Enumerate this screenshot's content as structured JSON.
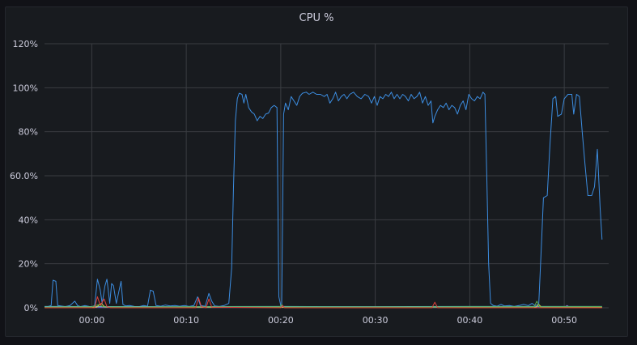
{
  "panel": {
    "title": "CPU %"
  },
  "chart_data": {
    "type": "line",
    "title": "CPU %",
    "ylim": [
      0,
      120
    ],
    "y_ticks": [
      "0%",
      "20%",
      "40%",
      "60.0%",
      "80%",
      "100%",
      "120%"
    ],
    "y_tick_values": [
      0,
      20,
      40,
      60,
      80,
      100,
      120
    ],
    "x_domain_minutes": [
      -5,
      54.7
    ],
    "x_ticks": [
      "00:00",
      "00:10",
      "00:20",
      "00:30",
      "00:40",
      "00:50"
    ],
    "x_tick_values": [
      0,
      10,
      20,
      30,
      40,
      50
    ],
    "grid": true,
    "colors": {
      "panel_bg": "#181b1f",
      "grid": "#3a3d42",
      "text": "#ccccdc",
      "cpu_main": "#3c8de0",
      "red": "#e0403a",
      "green": "#5aa64b",
      "yellow": "#d9c94a",
      "cyan": "#5ab8c8",
      "purple": "#9a6ad6"
    },
    "series": [
      {
        "color_key": "cpu_main",
        "points": [
          [
            -5.0,
            0.5
          ],
          [
            -4.6,
            0.6
          ],
          [
            -4.3,
            1.0
          ],
          [
            -4.1,
            12.5
          ],
          [
            -3.8,
            12.0
          ],
          [
            -3.6,
            1.0
          ],
          [
            -3.3,
            0.8
          ],
          [
            -2.8,
            0.5
          ],
          [
            -2.3,
            1.0
          ],
          [
            -1.8,
            3.0
          ],
          [
            -1.5,
            1.0
          ],
          [
            -1.2,
            0.5
          ],
          [
            -0.7,
            1.0
          ],
          [
            -0.3,
            0.6
          ],
          [
            0.0,
            0.5
          ],
          [
            0.3,
            1.0
          ],
          [
            0.6,
            13.0
          ],
          [
            0.9,
            8.0
          ],
          [
            1.1,
            2.0
          ],
          [
            1.4,
            10.0
          ],
          [
            1.6,
            13.0
          ],
          [
            1.9,
            2.0
          ],
          [
            2.1,
            11.0
          ],
          [
            2.3,
            10.0
          ],
          [
            2.6,
            2.0
          ],
          [
            2.9,
            8.0
          ],
          [
            3.1,
            12.0
          ],
          [
            3.3,
            1.5
          ],
          [
            3.6,
            0.8
          ],
          [
            4.0,
            1.0
          ],
          [
            4.5,
            0.6
          ],
          [
            5.0,
            0.5
          ],
          [
            5.5,
            1.0
          ],
          [
            5.9,
            0.7
          ],
          [
            6.2,
            8.0
          ],
          [
            6.5,
            7.5
          ],
          [
            6.8,
            1.0
          ],
          [
            7.3,
            0.7
          ],
          [
            7.8,
            1.2
          ],
          [
            8.3,
            0.8
          ],
          [
            8.8,
            1.0
          ],
          [
            9.3,
            0.7
          ],
          [
            9.8,
            1.0
          ],
          [
            10.3,
            0.6
          ],
          [
            10.8,
            1.0
          ],
          [
            11.2,
            5.0
          ],
          [
            11.5,
            1.0
          ],
          [
            12.0,
            0.7
          ],
          [
            12.4,
            6.5
          ],
          [
            12.7,
            3.0
          ],
          [
            13.0,
            0.8
          ],
          [
            13.5,
            0.6
          ],
          [
            14.0,
            1.0
          ],
          [
            14.5,
            2.0
          ],
          [
            14.8,
            18.0
          ],
          [
            15.0,
            55.0
          ],
          [
            15.2,
            85.0
          ],
          [
            15.4,
            95.0
          ],
          [
            15.6,
            97.5
          ],
          [
            15.9,
            97.0
          ],
          [
            16.1,
            93.0
          ],
          [
            16.3,
            97.0
          ],
          [
            16.6,
            91.0
          ],
          [
            16.9,
            89.0
          ],
          [
            17.2,
            88.0
          ],
          [
            17.5,
            85.0
          ],
          [
            17.8,
            87.0
          ],
          [
            18.1,
            86.0
          ],
          [
            18.4,
            88.0
          ],
          [
            18.7,
            88.5
          ],
          [
            19.0,
            91.0
          ],
          [
            19.3,
            92.0
          ],
          [
            19.6,
            91.0
          ],
          [
            19.8,
            5.0
          ],
          [
            20.0,
            1.0
          ],
          [
            20.1,
            0.5
          ],
          [
            20.3,
            88.0
          ],
          [
            20.5,
            93.0
          ],
          [
            20.8,
            90.0
          ],
          [
            21.1,
            96.0
          ],
          [
            21.4,
            94.0
          ],
          [
            21.7,
            92.0
          ],
          [
            22.0,
            96.0
          ],
          [
            22.3,
            97.5
          ],
          [
            22.7,
            98.0
          ],
          [
            23.0,
            97.0
          ],
          [
            23.4,
            98.0
          ],
          [
            23.8,
            97.0
          ],
          [
            24.2,
            97.0
          ],
          [
            24.6,
            96.0
          ],
          [
            24.9,
            97.0
          ],
          [
            25.2,
            93.0
          ],
          [
            25.5,
            95.0
          ],
          [
            25.8,
            98.0
          ],
          [
            26.1,
            94.0
          ],
          [
            26.4,
            96.0
          ],
          [
            26.7,
            97.0
          ],
          [
            27.0,
            95.0
          ],
          [
            27.3,
            97.0
          ],
          [
            27.7,
            98.0
          ],
          [
            28.1,
            96.0
          ],
          [
            28.5,
            95.0
          ],
          [
            28.9,
            97.0
          ],
          [
            29.3,
            96.0
          ],
          [
            29.6,
            93.0
          ],
          [
            29.9,
            96.0
          ],
          [
            30.2,
            92.0
          ],
          [
            30.5,
            96.0
          ],
          [
            30.8,
            95.0
          ],
          [
            31.1,
            97.0
          ],
          [
            31.4,
            96.0
          ],
          [
            31.7,
            98.0
          ],
          [
            32.0,
            95.0
          ],
          [
            32.3,
            97.0
          ],
          [
            32.6,
            95.0
          ],
          [
            32.9,
            97.0
          ],
          [
            33.2,
            96.0
          ],
          [
            33.5,
            94.0
          ],
          [
            33.8,
            97.0
          ],
          [
            34.1,
            95.0
          ],
          [
            34.4,
            96.0
          ],
          [
            34.7,
            98.0
          ],
          [
            35.0,
            93.0
          ],
          [
            35.3,
            96.0
          ],
          [
            35.6,
            92.0
          ],
          [
            35.9,
            94.0
          ],
          [
            36.1,
            84.0
          ],
          [
            36.3,
            87.0
          ],
          [
            36.6,
            90.0
          ],
          [
            36.9,
            92.0
          ],
          [
            37.2,
            91.0
          ],
          [
            37.5,
            93.0
          ],
          [
            37.8,
            90.0
          ],
          [
            38.1,
            92.0
          ],
          [
            38.4,
            91.0
          ],
          [
            38.7,
            88.0
          ],
          [
            39.0,
            92.0
          ],
          [
            39.3,
            94.0
          ],
          [
            39.6,
            90.0
          ],
          [
            39.9,
            97.0
          ],
          [
            40.2,
            95.0
          ],
          [
            40.5,
            94.0
          ],
          [
            40.8,
            96.0
          ],
          [
            41.1,
            95.0
          ],
          [
            41.4,
            98.0
          ],
          [
            41.6,
            97.0
          ],
          [
            41.8,
            60.0
          ],
          [
            42.0,
            20.0
          ],
          [
            42.2,
            2.0
          ],
          [
            42.5,
            1.0
          ],
          [
            42.9,
            0.7
          ],
          [
            43.3,
            1.5
          ],
          [
            43.7,
            0.8
          ],
          [
            44.2,
            1.0
          ],
          [
            44.7,
            0.6
          ],
          [
            45.2,
            1.0
          ],
          [
            45.7,
            1.5
          ],
          [
            46.2,
            1.0
          ],
          [
            46.6,
            2.0
          ],
          [
            46.9,
            1.0
          ],
          [
            47.3,
            1.5
          ],
          [
            47.6,
            30.0
          ],
          [
            47.8,
            50.0
          ],
          [
            48.2,
            51.0
          ],
          [
            48.5,
            75.0
          ],
          [
            48.8,
            95.0
          ],
          [
            49.1,
            96.0
          ],
          [
            49.3,
            87.0
          ],
          [
            49.7,
            88.0
          ],
          [
            50.0,
            95.0
          ],
          [
            50.4,
            97.0
          ],
          [
            50.8,
            97.0
          ],
          [
            51.0,
            88.0
          ],
          [
            51.3,
            97.0
          ],
          [
            51.6,
            96.0
          ],
          [
            51.9,
            80.0
          ],
          [
            52.2,
            65.0
          ],
          [
            52.5,
            51.0
          ],
          [
            52.9,
            51.0
          ],
          [
            53.2,
            55.0
          ],
          [
            53.5,
            72.0
          ],
          [
            53.8,
            45.0
          ],
          [
            54.0,
            31.0
          ]
        ]
      },
      {
        "color_key": "red",
        "points": [
          [
            -5.0,
            0
          ],
          [
            0.3,
            0
          ],
          [
            0.6,
            5.0
          ],
          [
            0.9,
            1.0
          ],
          [
            1.3,
            4.0
          ],
          [
            1.6,
            0.5
          ],
          [
            2.0,
            0
          ],
          [
            11.0,
            0
          ],
          [
            11.3,
            4.5
          ],
          [
            11.6,
            0.5
          ],
          [
            12.1,
            0
          ],
          [
            12.4,
            4.0
          ],
          [
            12.7,
            0.3
          ],
          [
            20.0,
            0
          ],
          [
            20.2,
            1.0
          ],
          [
            20.4,
            0
          ],
          [
            36.0,
            0
          ],
          [
            36.3,
            2.5
          ],
          [
            36.6,
            0
          ],
          [
            54.0,
            0
          ]
        ]
      },
      {
        "color_key": "green",
        "points": [
          [
            -5.0,
            0.3
          ],
          [
            0.0,
            0.4
          ],
          [
            0.8,
            1.5
          ],
          [
            1.2,
            0.4
          ],
          [
            5.0,
            0.3
          ],
          [
            10.0,
            0.4
          ],
          [
            19.9,
            0.4
          ],
          [
            20.1,
            1.5
          ],
          [
            20.3,
            0.4
          ],
          [
            30.0,
            0.3
          ],
          [
            40.0,
            0.4
          ],
          [
            46.8,
            0.4
          ],
          [
            47.1,
            3.0
          ],
          [
            47.4,
            0.4
          ],
          [
            54.0,
            0.5
          ]
        ]
      },
      {
        "color_key": "yellow",
        "points": [
          [
            -5.0,
            0.2
          ],
          [
            0.5,
            0.3
          ],
          [
            1.0,
            2.0
          ],
          [
            1.4,
            0.3
          ],
          [
            15.0,
            0.2
          ],
          [
            30.0,
            0.3
          ],
          [
            47.0,
            0.2
          ],
          [
            47.3,
            1.5
          ],
          [
            47.6,
            0.2
          ],
          [
            54.0,
            0.3
          ]
        ]
      },
      {
        "color_key": "cyan",
        "points": [
          [
            -5.0,
            0.6
          ],
          [
            10.0,
            0.5
          ],
          [
            20.0,
            0.6
          ],
          [
            30.0,
            0.5
          ],
          [
            40.0,
            0.6
          ],
          [
            54.0,
            0.6
          ]
        ]
      },
      {
        "color_key": "purple",
        "points": [
          [
            -5.0,
            0.1
          ],
          [
            20.0,
            0.2
          ],
          [
            50.0,
            0.1
          ],
          [
            50.3,
            1.0
          ],
          [
            50.6,
            0.1
          ],
          [
            54.0,
            0.2
          ]
        ]
      }
    ]
  }
}
